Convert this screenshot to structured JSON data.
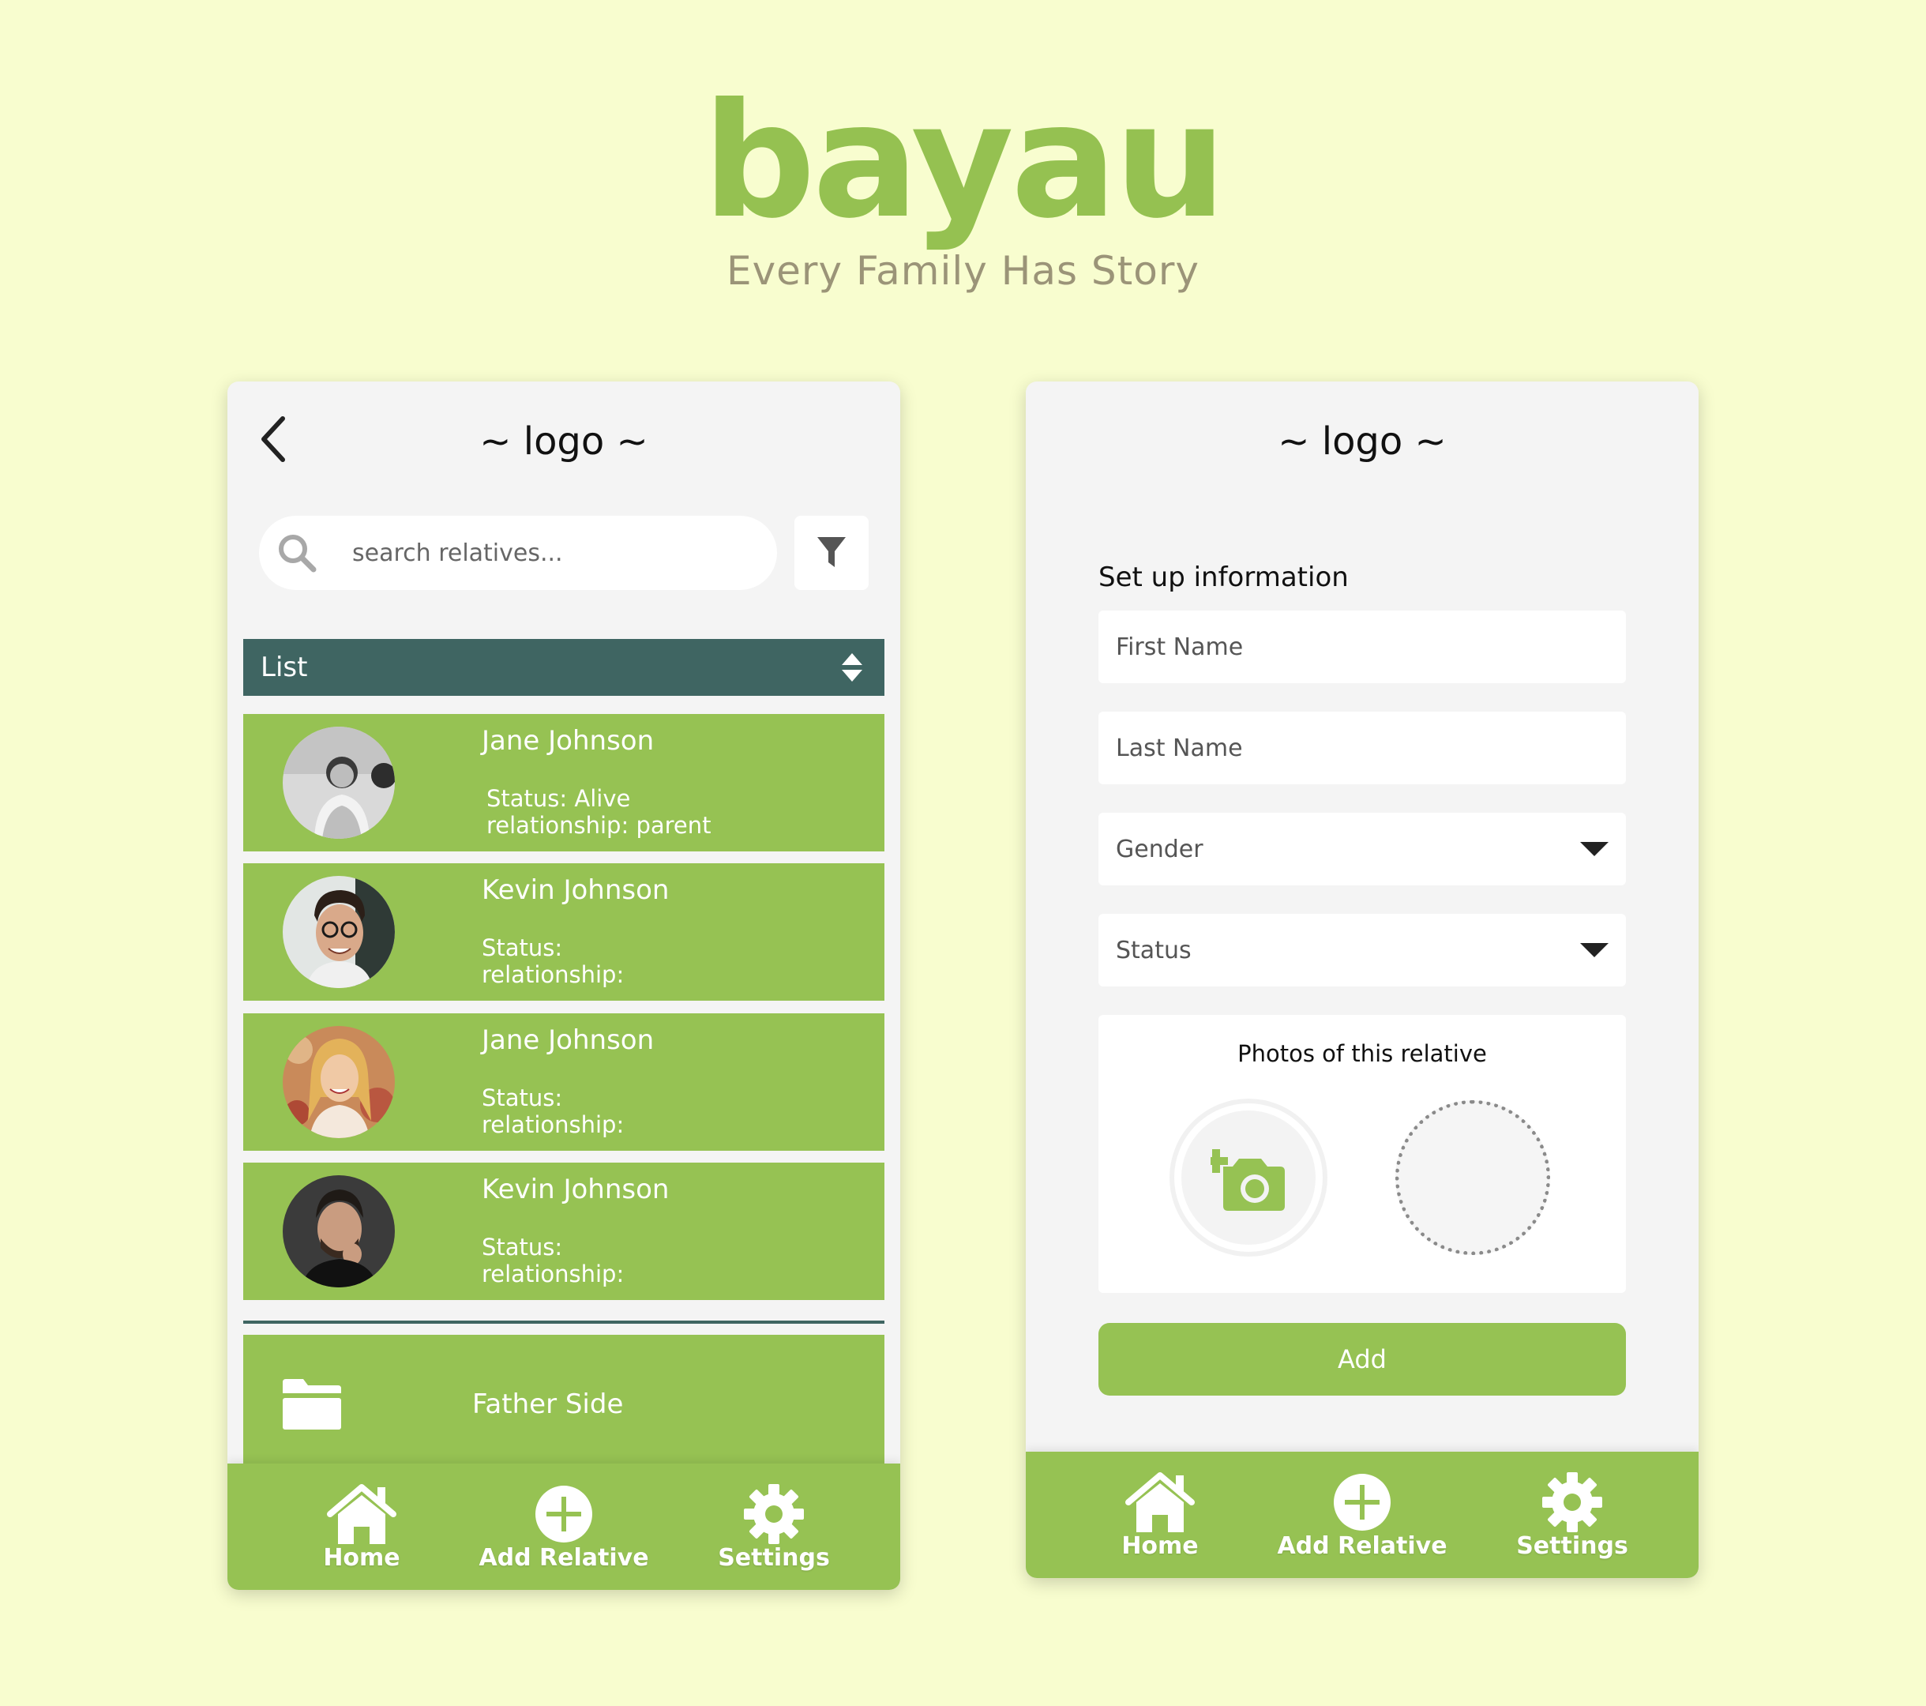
{
  "brand": {
    "name": "bayau",
    "tagline": "Every Family Has Story",
    "accent": "#95c151",
    "background": "#f8fdcf"
  },
  "list_screen": {
    "logo": "~ logo ~",
    "back_icon": "chevron-left-icon",
    "search": {
      "placeholder": "search relatives...",
      "icon": "search-icon"
    },
    "filter_icon": "filter-icon",
    "list_header": {
      "label": "List",
      "sort_icon": "sort-icon",
      "color": "#3f6562"
    },
    "relatives": [
      {
        "name": "Jane Johnson",
        "status": "Status: Alive",
        "relationship": "relationship: parent"
      },
      {
        "name": "Kevin Johnson",
        "status": "Status:",
        "relationship": "relationship:"
      },
      {
        "name": "Jane Johnson",
        "status": "Status:",
        "relationship": "relationship:"
      },
      {
        "name": "Kevin Johnson",
        "status": "Status:",
        "relationship": "relationship:"
      }
    ],
    "folder": {
      "label": "Father Side",
      "icon": "folder-icon"
    },
    "card_color": "#96c253"
  },
  "nav": {
    "home": "Home",
    "add_relative": "Add Relative",
    "settings": "Settings"
  },
  "form_screen": {
    "logo": "~ logo ~",
    "title": "Set up information",
    "first_name_placeholder": "First Name",
    "last_name_placeholder": "Last Name",
    "gender_label": "Gender",
    "status_label": "Status",
    "photos_title": "Photos of this relative",
    "add_button": "Add"
  }
}
